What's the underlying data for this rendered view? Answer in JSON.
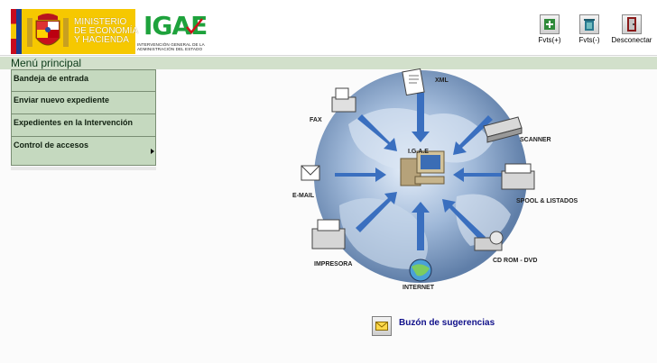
{
  "header": {
    "ministry": {
      "line1": "MINISTERIO",
      "line2": "DE ECONOMÍA",
      "line3": "Y HACIENDA"
    },
    "igae": {
      "title": "IGAE",
      "subtitle_line1": "INTERVENCIÓN GENERAL DE LA",
      "subtitle_line2": "ADMINISTRACIÓN DEL ESTADO"
    }
  },
  "toolbar": {
    "add_label": "Fvts(+)",
    "remove_label": "Fvts(-)",
    "disconnect_label": "Desconectar"
  },
  "menu": {
    "title": "Menú principal",
    "items": [
      {
        "label": "Bandeja de entrada"
      },
      {
        "label": "Enviar nuevo expediente"
      },
      {
        "label": "Expedientes en la Intervención"
      },
      {
        "label": "Control de accesos"
      }
    ]
  },
  "diagram": {
    "center": "I.G.A.E",
    "nodes": {
      "xml": "XML",
      "fax": "FAX",
      "scanner": "SCANNER",
      "email": "E-MAIL",
      "spool": "SPOOL & LISTADOS",
      "impresora": "IMPRESORA",
      "cdrom": "CD ROM - DVD",
      "internet": "INTERNET"
    }
  },
  "suggestions": {
    "label": "Buzón de sugerencias"
  },
  "colors": {
    "menu_bg": "#c5d9bf",
    "menu_bar": "#d2e0cb",
    "igae_green": "#1ea23c",
    "link_blue": "#10108a"
  }
}
